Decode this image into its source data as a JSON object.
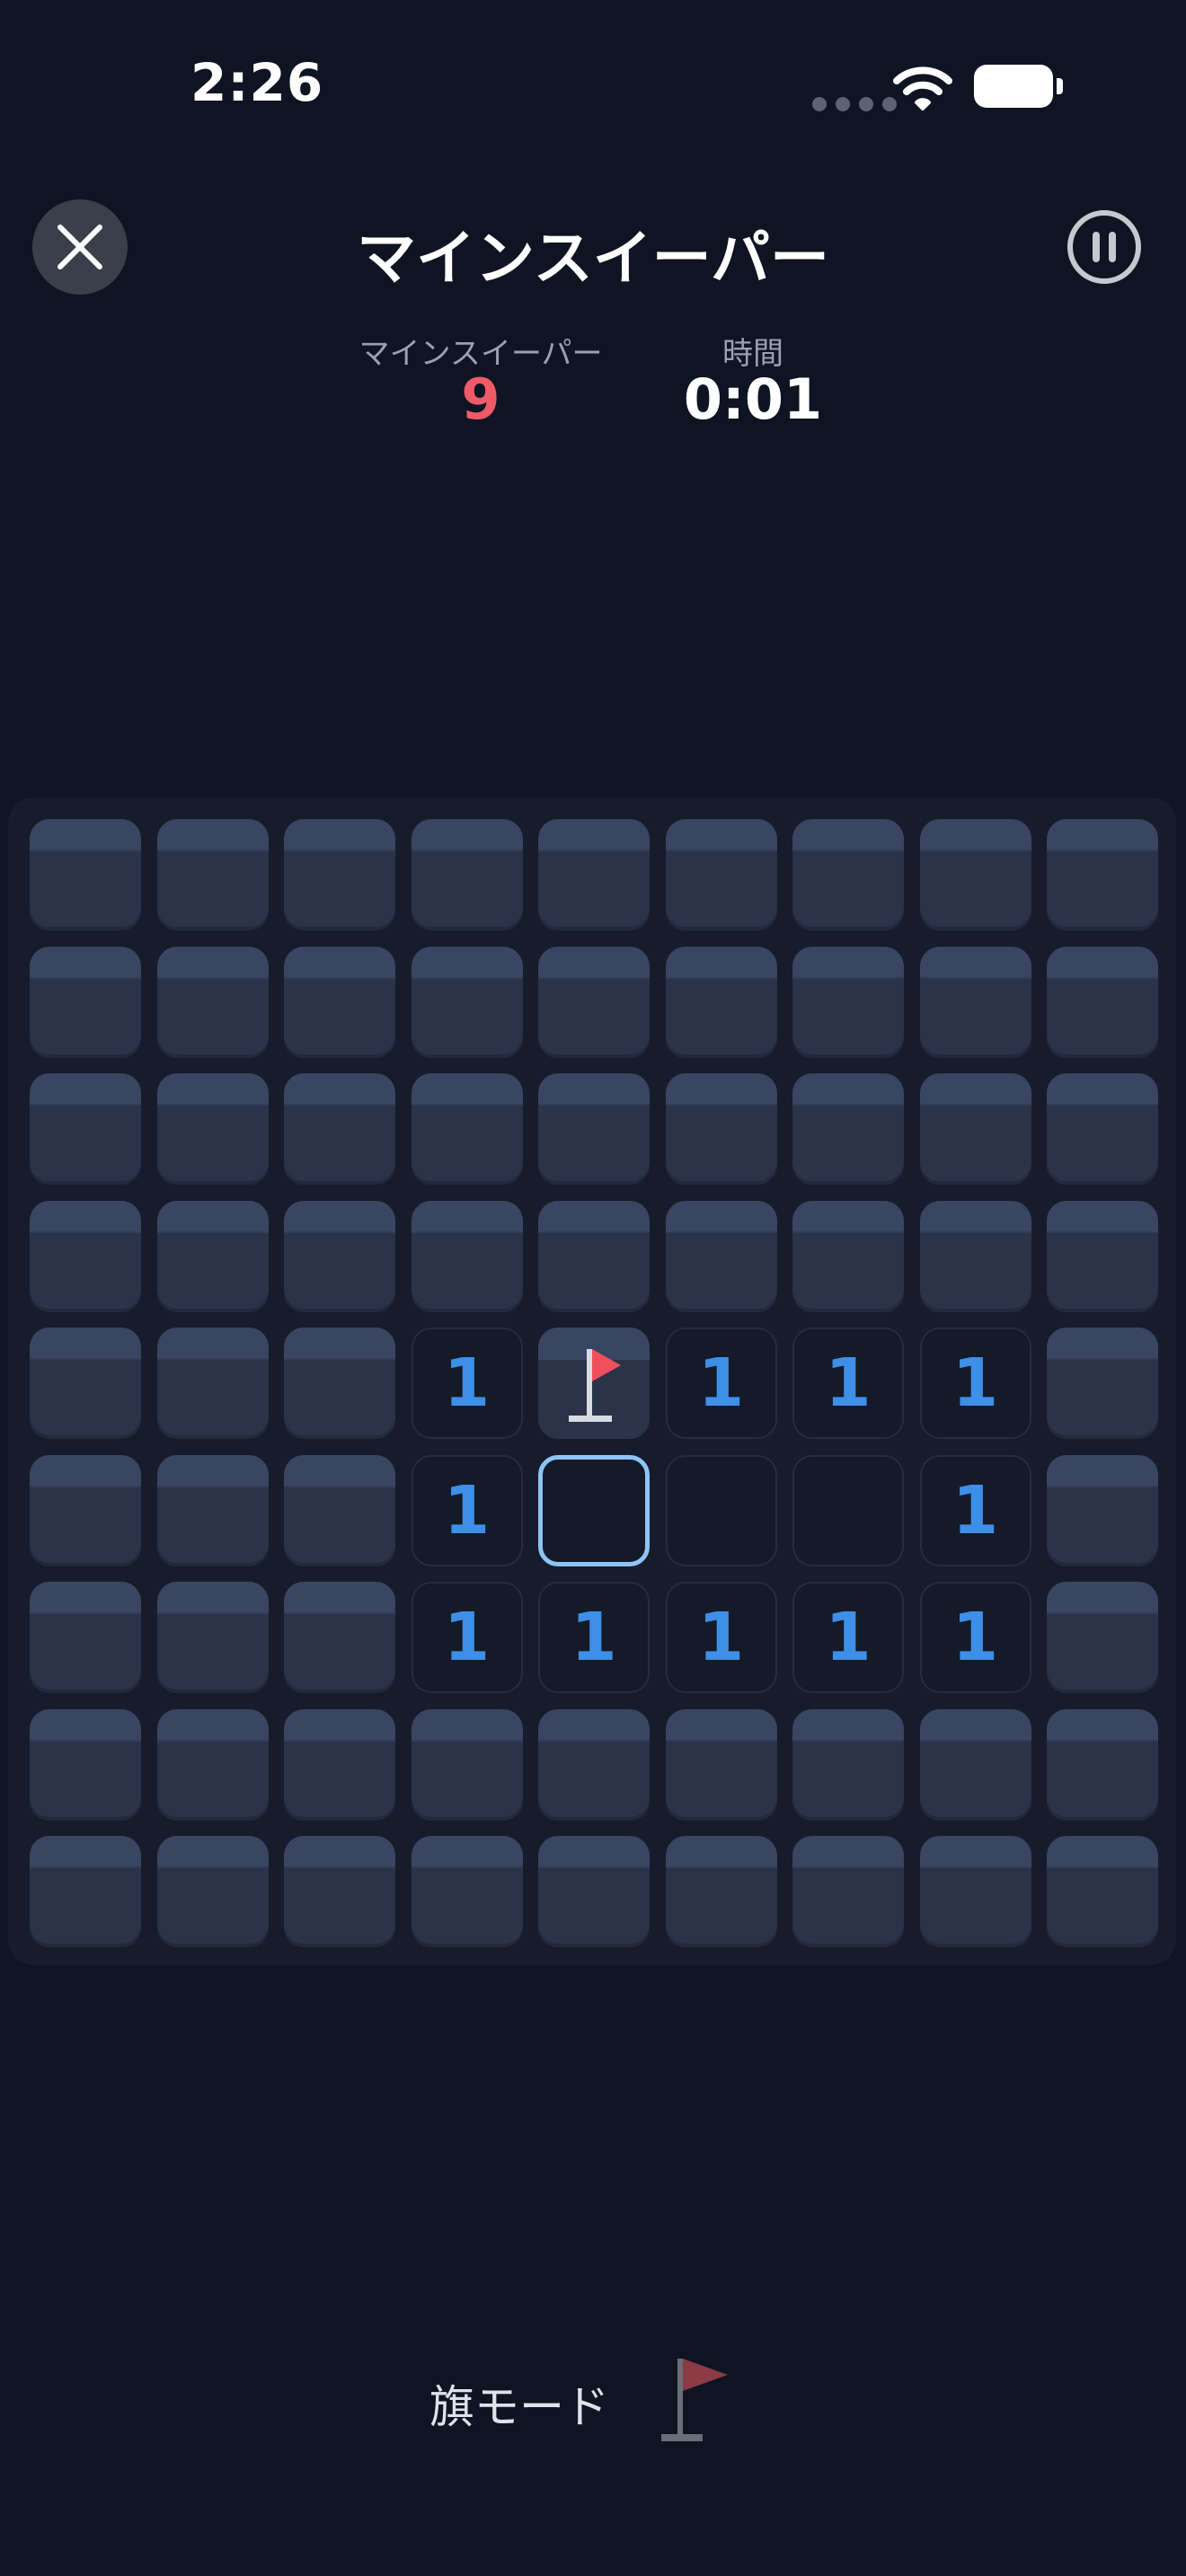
{
  "status_bar": {
    "time": "2:26"
  },
  "header": {
    "title": "マインスイーパー"
  },
  "stats": {
    "mines_label": "マインスイーパー",
    "mines_value": "9",
    "time_label": "時間",
    "time_value": "0:01"
  },
  "board": {
    "rows": 9,
    "cols": 9,
    "cells": [
      [
        "h",
        "h",
        "h",
        "h",
        "h",
        "h",
        "h",
        "h",
        "h"
      ],
      [
        "h",
        "h",
        "h",
        "h",
        "h",
        "h",
        "h",
        "h",
        "h"
      ],
      [
        "h",
        "h",
        "h",
        "h",
        "h",
        "h",
        "h",
        "h",
        "h"
      ],
      [
        "h",
        "h",
        "h",
        "h",
        "h",
        "h",
        "h",
        "h",
        "h"
      ],
      [
        "h",
        "h",
        "h",
        "1",
        "f",
        "1",
        "1",
        "1",
        "h"
      ],
      [
        "h",
        "h",
        "h",
        "1",
        "s",
        "0",
        "0",
        "1",
        "h"
      ],
      [
        "h",
        "h",
        "h",
        "1",
        "1",
        "1",
        "1",
        "1",
        "h"
      ],
      [
        "h",
        "h",
        "h",
        "h",
        "h",
        "h",
        "h",
        "h",
        "h"
      ],
      [
        "h",
        "h",
        "h",
        "h",
        "h",
        "h",
        "h",
        "h",
        "h"
      ]
    ]
  },
  "footer": {
    "flag_mode_label": "旗モード"
  },
  "colors": {
    "background": "#0f1423",
    "mine_count": "#f05a67",
    "number_one": "#3d8fe8",
    "flag_red": "#f0505c",
    "selected_border": "#8ec4f5"
  },
  "icons": {
    "close": "close-icon",
    "pause": "pause-icon",
    "flag": "flag-icon",
    "wifi": "wifi-icon",
    "battery": "battery-icon"
  }
}
